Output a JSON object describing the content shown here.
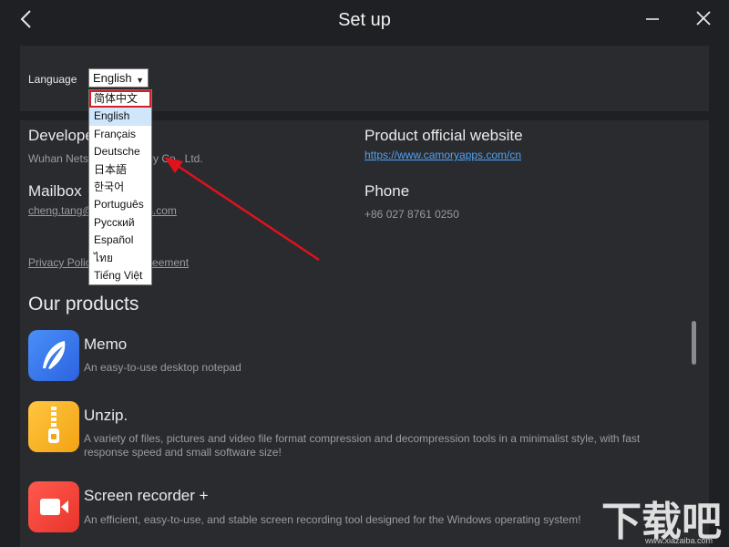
{
  "window": {
    "title": "Set up"
  },
  "language": {
    "label": "Language",
    "selected": "English",
    "options": [
      "简体中文",
      "English",
      "Français",
      "Deutsche",
      "日本語",
      "한국어",
      "Português",
      "Русский",
      "Español",
      "ไทย",
      "Tiếng Việt"
    ]
  },
  "info": {
    "developer_heading": "Developer",
    "developer_value": "Wuhan Netsoft Technology Co., Ltd.",
    "website_heading": "Product official website",
    "website_link": "https://www.camoryapps.com/cn",
    "mailbox_heading": "Mailbox",
    "mailbox_value": "cheng.tang@camoryapps.com",
    "phone_heading": "Phone",
    "phone_value": "+86 027 8761 0250",
    "privacy_link": "Privacy Policy & User Agreement"
  },
  "products": {
    "title": "Our products",
    "items": [
      {
        "name": "Memo",
        "desc": "An easy-to-use desktop notepad",
        "icon": "feather-icon",
        "color": "#3b7cf3"
      },
      {
        "name": "Unzip.",
        "desc": "A variety of files, pictures and video file format compression and decompression tools in a minimalist style, with fast response speed and small software size!",
        "icon": "zipper-icon",
        "color": "#f6b52a"
      },
      {
        "name": "Screen recorder +",
        "desc": "An efficient, easy-to-use, and stable screen recording tool designed for the Windows operating system!",
        "icon": "camera-icon",
        "color": "#f0483e"
      }
    ]
  },
  "watermark": {
    "text": "下载吧",
    "url": "www.xiazaiba.com"
  },
  "colors": {
    "background": "#1f2023",
    "panel": "#2a2b2f",
    "link": "#4ea3f7",
    "highlight": "#d0202a"
  }
}
